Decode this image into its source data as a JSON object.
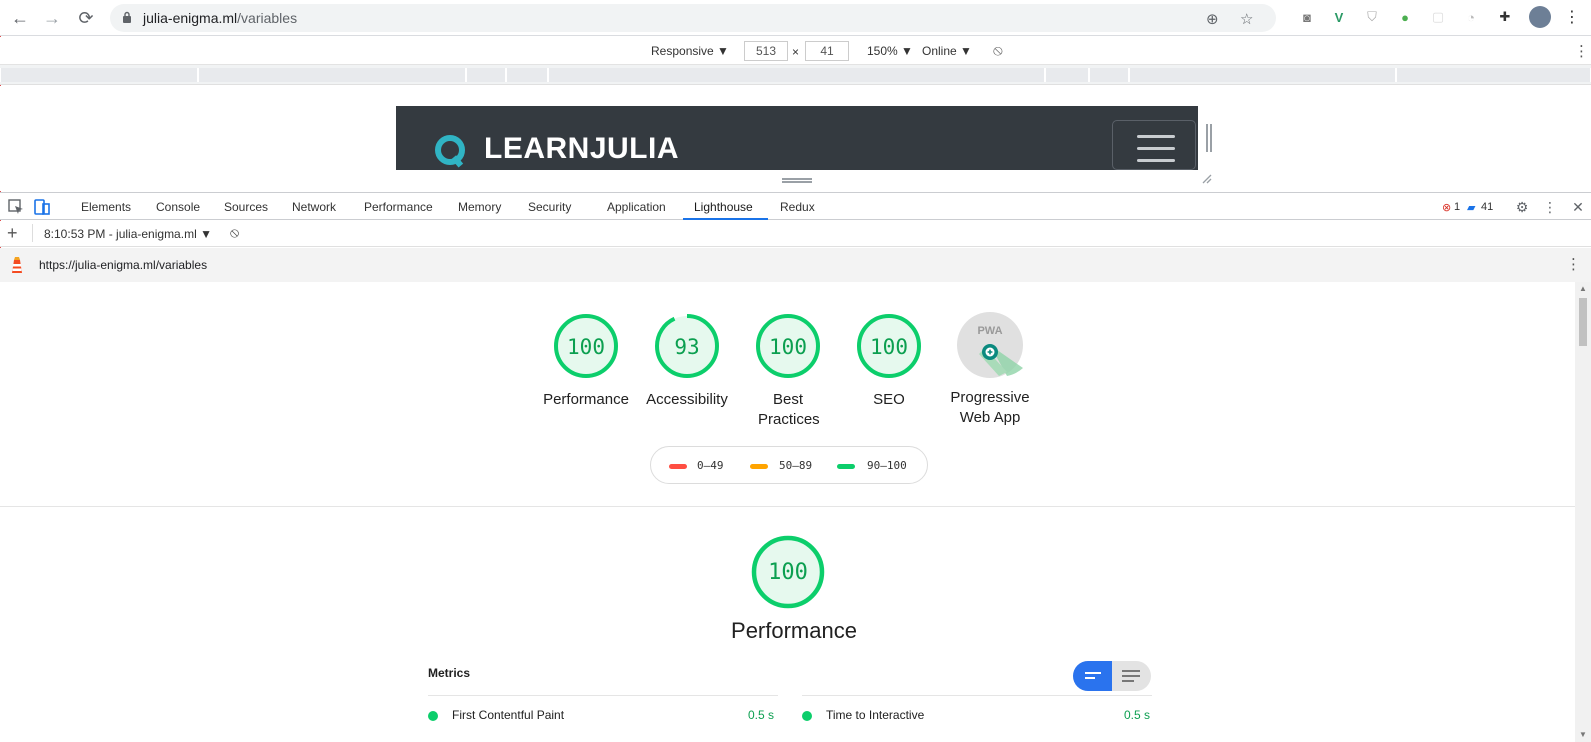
{
  "browser": {
    "url_host": "julia-enigma.ml",
    "url_path": "/variables"
  },
  "device_toolbar": {
    "device": "Responsive ▼",
    "width": "513",
    "times": "×",
    "height": "41",
    "zoom": "150% ▼",
    "throttle": "Online ▼"
  },
  "site": {
    "brand": "LEARNJULIA"
  },
  "devtools": {
    "tabs": [
      "Elements",
      "Console",
      "Sources",
      "Network",
      "Performance",
      "Memory",
      "Security",
      "Application",
      "Lighthouse",
      "Redux"
    ],
    "active_tab": "Lighthouse",
    "error_count": "1",
    "message_count": "41"
  },
  "lighthouse": {
    "report_selector": "8:10:53 PM - julia-enigma.ml ▼",
    "report_url": "https://julia-enigma.ml/variables",
    "gauges": [
      {
        "score": "100",
        "value": 100,
        "label": "Performance"
      },
      {
        "score": "93",
        "value": 93,
        "label": "Accessibility"
      },
      {
        "score": "100",
        "value": 100,
        "label": "Best Practices"
      },
      {
        "score": "100",
        "value": 100,
        "label": "SEO"
      }
    ],
    "pwa_label": "Progressive Web App",
    "pwa_badge": "PWA",
    "legend": [
      "0–49",
      "50–89",
      "90–100"
    ],
    "colors": {
      "fail": "#ff4e42",
      "average": "#ffa400",
      "pass": "#0cce6b"
    },
    "section_score": "100",
    "section_score_value": 100,
    "section_title": "Performance",
    "metrics_header": "Metrics",
    "metrics": [
      {
        "label": "First Contentful Paint",
        "value": "0.5 s"
      },
      {
        "label": "Time to Interactive",
        "value": "0.5 s"
      }
    ]
  }
}
